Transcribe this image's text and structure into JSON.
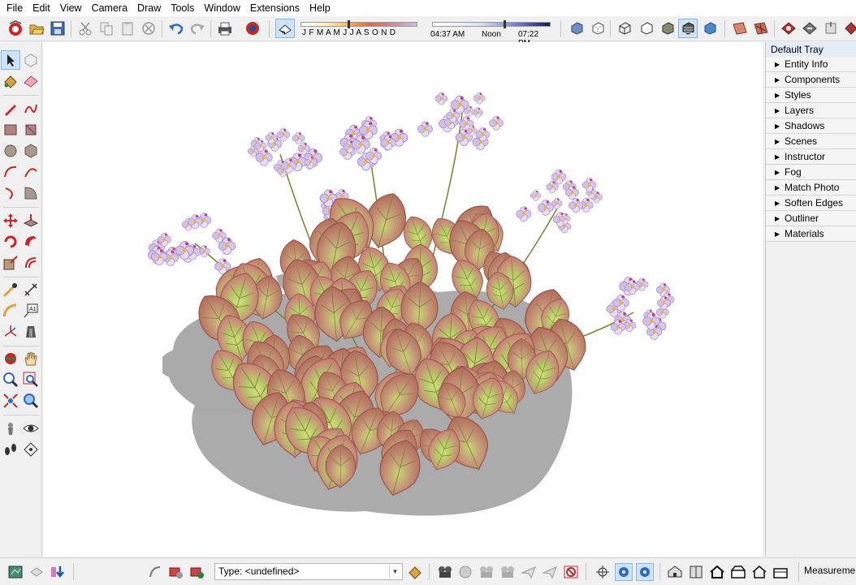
{
  "menu": [
    "File",
    "Edit",
    "View",
    "Camera",
    "Draw",
    "Tools",
    "Window",
    "Extensions",
    "Help"
  ],
  "toolbar": {
    "months_label": "J F M A M J J A S O N D",
    "time_start": "04:37 AM",
    "time_mid": "Noon",
    "time_end": "07:22 PM"
  },
  "tray": {
    "title": "Default Tray",
    "panels": [
      "Entity Info",
      "Components",
      "Styles",
      "Layers",
      "Shadows",
      "Scenes",
      "Instructor",
      "Fog",
      "Match Photo",
      "Soften Edges",
      "Outliner",
      "Materials"
    ]
  },
  "status": {
    "type_text": "Type: <undefined>",
    "measurements_label": "Measurements"
  },
  "colors": {
    "accent": "#cde3f7",
    "leaf_rim": "#c97c72",
    "leaf_center": "#c8d86a",
    "flower": "#d9c8ea",
    "shadow": "#a6a6a6"
  }
}
